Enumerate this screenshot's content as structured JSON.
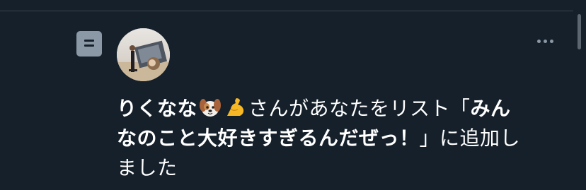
{
  "notification": {
    "user_display_name": "りくなな",
    "user_emojis": [
      "dog-face-emoji",
      "flexed-biceps-emoji"
    ],
    "message_prefix": "さんがあなたをリスト「",
    "list_name_line1": "みん",
    "list_name_line2": "なのこと大好きすぎるんだぜっ！",
    "message_suffix": "」に追加し",
    "message_suffix_line3": "ました",
    "type_icon": "list-icon",
    "more_icon": "more-horizontal-icon"
  },
  "colors": {
    "background": "#15202b",
    "text": "#ffffff",
    "secondary": "#8b98a5",
    "divider": "#38444d"
  }
}
